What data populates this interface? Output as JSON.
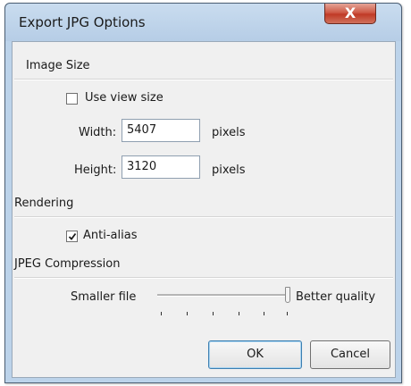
{
  "window": {
    "title": "Export JPG Options",
    "close_glyph": "X"
  },
  "image_size": {
    "header": "Image Size",
    "use_view_size": {
      "label": "Use view size",
      "checked": false
    },
    "width": {
      "label": "Width:",
      "value": "5407",
      "unit": "pixels"
    },
    "height": {
      "label": "Height:",
      "value": "3120",
      "unit": "pixels"
    }
  },
  "rendering": {
    "header": "Rendering",
    "anti_alias": {
      "label": "Anti-alias",
      "checked": true
    }
  },
  "jpeg_compression": {
    "header": "JPEG Compression",
    "min_label": "Smaller file",
    "max_label": "Better quality",
    "level": 1.0,
    "tick_count": 6
  },
  "buttons": {
    "ok": "OK",
    "cancel": "Cancel"
  },
  "colors": {
    "close_button": "#c03a26",
    "window_frame": "#bcd3ea",
    "dialog_bg": "#f0f0f0"
  },
  "icons": {
    "close": "close-icon",
    "check": "checkmark-icon"
  }
}
